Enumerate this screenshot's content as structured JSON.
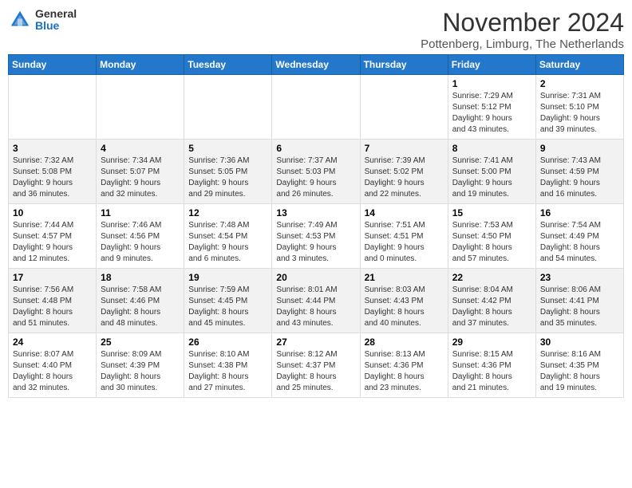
{
  "header": {
    "logo_general": "General",
    "logo_blue": "Blue",
    "month_title": "November 2024",
    "location": "Pottenberg, Limburg, The Netherlands"
  },
  "days_of_week": [
    "Sunday",
    "Monday",
    "Tuesday",
    "Wednesday",
    "Thursday",
    "Friday",
    "Saturday"
  ],
  "weeks": [
    {
      "days": [
        {
          "num": "",
          "info": ""
        },
        {
          "num": "",
          "info": ""
        },
        {
          "num": "",
          "info": ""
        },
        {
          "num": "",
          "info": ""
        },
        {
          "num": "",
          "info": ""
        },
        {
          "num": "1",
          "info": "Sunrise: 7:29 AM\nSunset: 5:12 PM\nDaylight: 9 hours\nand 43 minutes."
        },
        {
          "num": "2",
          "info": "Sunrise: 7:31 AM\nSunset: 5:10 PM\nDaylight: 9 hours\nand 39 minutes."
        }
      ]
    },
    {
      "days": [
        {
          "num": "3",
          "info": "Sunrise: 7:32 AM\nSunset: 5:08 PM\nDaylight: 9 hours\nand 36 minutes."
        },
        {
          "num": "4",
          "info": "Sunrise: 7:34 AM\nSunset: 5:07 PM\nDaylight: 9 hours\nand 32 minutes."
        },
        {
          "num": "5",
          "info": "Sunrise: 7:36 AM\nSunset: 5:05 PM\nDaylight: 9 hours\nand 29 minutes."
        },
        {
          "num": "6",
          "info": "Sunrise: 7:37 AM\nSunset: 5:03 PM\nDaylight: 9 hours\nand 26 minutes."
        },
        {
          "num": "7",
          "info": "Sunrise: 7:39 AM\nSunset: 5:02 PM\nDaylight: 9 hours\nand 22 minutes."
        },
        {
          "num": "8",
          "info": "Sunrise: 7:41 AM\nSunset: 5:00 PM\nDaylight: 9 hours\nand 19 minutes."
        },
        {
          "num": "9",
          "info": "Sunrise: 7:43 AM\nSunset: 4:59 PM\nDaylight: 9 hours\nand 16 minutes."
        }
      ]
    },
    {
      "days": [
        {
          "num": "10",
          "info": "Sunrise: 7:44 AM\nSunset: 4:57 PM\nDaylight: 9 hours\nand 12 minutes."
        },
        {
          "num": "11",
          "info": "Sunrise: 7:46 AM\nSunset: 4:56 PM\nDaylight: 9 hours\nand 9 minutes."
        },
        {
          "num": "12",
          "info": "Sunrise: 7:48 AM\nSunset: 4:54 PM\nDaylight: 9 hours\nand 6 minutes."
        },
        {
          "num": "13",
          "info": "Sunrise: 7:49 AM\nSunset: 4:53 PM\nDaylight: 9 hours\nand 3 minutes."
        },
        {
          "num": "14",
          "info": "Sunrise: 7:51 AM\nSunset: 4:51 PM\nDaylight: 9 hours\nand 0 minutes."
        },
        {
          "num": "15",
          "info": "Sunrise: 7:53 AM\nSunset: 4:50 PM\nDaylight: 8 hours\nand 57 minutes."
        },
        {
          "num": "16",
          "info": "Sunrise: 7:54 AM\nSunset: 4:49 PM\nDaylight: 8 hours\nand 54 minutes."
        }
      ]
    },
    {
      "days": [
        {
          "num": "17",
          "info": "Sunrise: 7:56 AM\nSunset: 4:48 PM\nDaylight: 8 hours\nand 51 minutes."
        },
        {
          "num": "18",
          "info": "Sunrise: 7:58 AM\nSunset: 4:46 PM\nDaylight: 8 hours\nand 48 minutes."
        },
        {
          "num": "19",
          "info": "Sunrise: 7:59 AM\nSunset: 4:45 PM\nDaylight: 8 hours\nand 45 minutes."
        },
        {
          "num": "20",
          "info": "Sunrise: 8:01 AM\nSunset: 4:44 PM\nDaylight: 8 hours\nand 43 minutes."
        },
        {
          "num": "21",
          "info": "Sunrise: 8:03 AM\nSunset: 4:43 PM\nDaylight: 8 hours\nand 40 minutes."
        },
        {
          "num": "22",
          "info": "Sunrise: 8:04 AM\nSunset: 4:42 PM\nDaylight: 8 hours\nand 37 minutes."
        },
        {
          "num": "23",
          "info": "Sunrise: 8:06 AM\nSunset: 4:41 PM\nDaylight: 8 hours\nand 35 minutes."
        }
      ]
    },
    {
      "days": [
        {
          "num": "24",
          "info": "Sunrise: 8:07 AM\nSunset: 4:40 PM\nDaylight: 8 hours\nand 32 minutes."
        },
        {
          "num": "25",
          "info": "Sunrise: 8:09 AM\nSunset: 4:39 PM\nDaylight: 8 hours\nand 30 minutes."
        },
        {
          "num": "26",
          "info": "Sunrise: 8:10 AM\nSunset: 4:38 PM\nDaylight: 8 hours\nand 27 minutes."
        },
        {
          "num": "27",
          "info": "Sunrise: 8:12 AM\nSunset: 4:37 PM\nDaylight: 8 hours\nand 25 minutes."
        },
        {
          "num": "28",
          "info": "Sunrise: 8:13 AM\nSunset: 4:36 PM\nDaylight: 8 hours\nand 23 minutes."
        },
        {
          "num": "29",
          "info": "Sunrise: 8:15 AM\nSunset: 4:36 PM\nDaylight: 8 hours\nand 21 minutes."
        },
        {
          "num": "30",
          "info": "Sunrise: 8:16 AM\nSunset: 4:35 PM\nDaylight: 8 hours\nand 19 minutes."
        }
      ]
    }
  ]
}
